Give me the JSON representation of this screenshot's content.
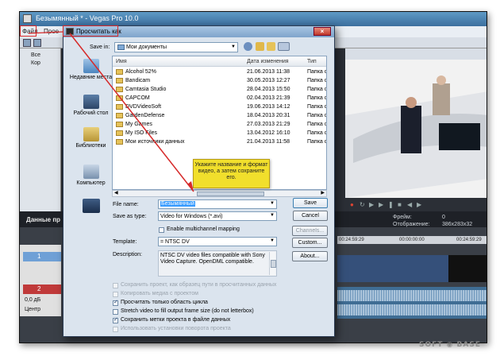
{
  "vegas": {
    "title": "Безымянный * - Vegas Pro 10.0",
    "menu": {
      "file": "Файл",
      "project": "Прое"
    },
    "explorer_items": [
      "Все",
      "Кор"
    ],
    "tab_label": "Данные пр",
    "preview": {
      "frame_label": "Фрейм:",
      "frame_value": "0",
      "display_label": "Отображение:",
      "display_value": "386x283x32"
    },
    "ruler_marks": [
      "00:24:59:29",
      "00:00:00:00",
      "00:24:59:29"
    ],
    "tracks": [
      {
        "number": "1",
        "color": "#6fa0d6"
      },
      {
        "number": "2",
        "color": "#c03a3a"
      }
    ],
    "track_volume": "0,0 дБ",
    "track_pan": "Центр"
  },
  "watermark": "SOFT ◉ BASE",
  "dialog": {
    "title": "Просчитать как",
    "close_glyph": "×",
    "save_in_label": "Save in:",
    "save_in_value": "Мои документы",
    "columns": {
      "name": "Имя",
      "date": "Дата изменения",
      "type": "Тип"
    },
    "files": [
      {
        "name": "Alcohol 52%",
        "date": "21.06.2013 11:38",
        "type": "Папка с ф"
      },
      {
        "name": "Bandicam",
        "date": "30.05.2013 12:27",
        "type": "Папка с ф"
      },
      {
        "name": "Camtasia Studio",
        "date": "28.04.2013 15:50",
        "type": "Папка с ф"
      },
      {
        "name": "CAPCOM",
        "date": "02.04.2013 21:39",
        "type": "Папка с ф"
      },
      {
        "name": "DVDVideoSoft",
        "date": "19.06.2013 14:12",
        "type": "Папка с ф"
      },
      {
        "name": "GardenDefense",
        "date": "18.04.2013 20:31",
        "type": "Папка с ф"
      },
      {
        "name": "My Games",
        "date": "27.03.2013 21:29",
        "type": "Папка с ф"
      },
      {
        "name": "My ISO Files",
        "date": "13.04.2012 16:10",
        "type": "Папка с ф"
      },
      {
        "name": "Мои источники данных",
        "date": "21.04.2013 11:58",
        "type": "Папка с ф"
      }
    ],
    "places": {
      "recent": "Недавние места",
      "desktop": "Рабочий стол",
      "libraries": "Библиотеки",
      "computer": "Компьютер"
    },
    "tooltip": "Укажите название и формат видео, а затем сохраните его.",
    "file_name_label": "File name:",
    "file_name_value": "Безымянный",
    "save_type_label": "Save as type:",
    "save_type_value": "Video for Windows (*.avi)",
    "save_button": "Save",
    "cancel_button": "Cancel",
    "multichannel_label": "Enable multichannel mapping",
    "channels_button": "Channels...",
    "template_label": "Template:",
    "template_value": "= NTSC DV",
    "custom_button": "Custom...",
    "description_label": "Description:",
    "description_text": "NTSC DV video files compatible with Sony Video Capture. OpenDML compatible.",
    "about_button": "About...",
    "options": [
      {
        "label": "Сохранить проект, как образец пути в просчитанных данных",
        "checked": false,
        "disabled": true
      },
      {
        "label": "Копировать медиа с проектом",
        "checked": false,
        "disabled": true
      },
      {
        "label": "Просчитать только область цикла",
        "checked": true,
        "disabled": false
      },
      {
        "label": "Stretch video to fill output frame size (do not letterbox)",
        "checked": false,
        "disabled": false
      },
      {
        "label": "Сохранить метки проекта в файле данных",
        "checked": true,
        "disabled": false
      },
      {
        "label": "Использовать установки поворота проекта",
        "checked": false,
        "disabled": true
      }
    ]
  },
  "annotation_color": "#d62a2a"
}
